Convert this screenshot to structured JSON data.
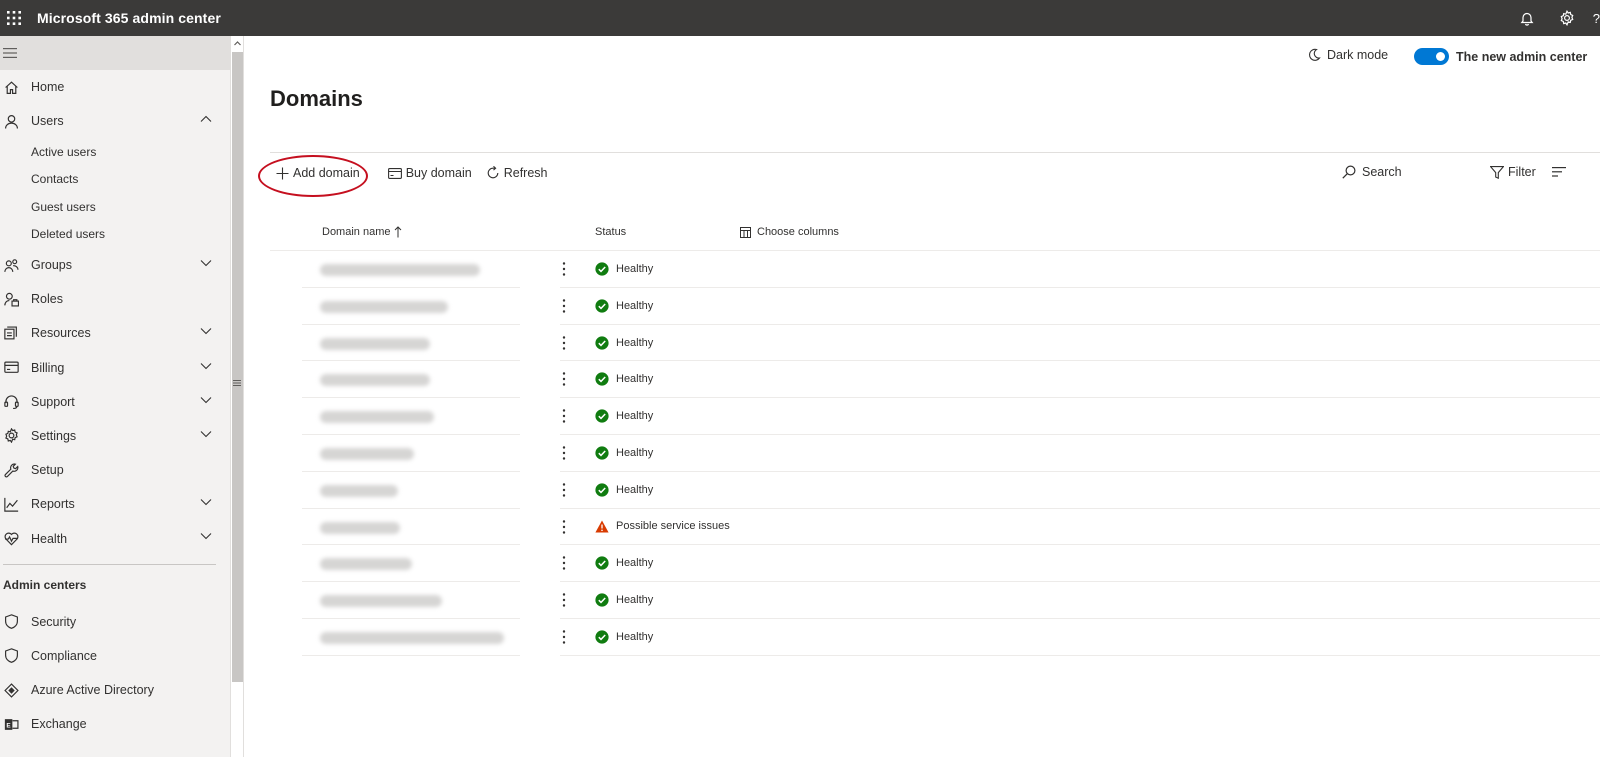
{
  "topbar": {
    "app_title": "Microsoft 365 admin center",
    "help": "?"
  },
  "sidebar": {
    "items": [
      {
        "label": "Home",
        "icon": "home-icon",
        "chevron": false
      },
      {
        "label": "Users",
        "icon": "user-icon",
        "chevron": "up"
      },
      {
        "label": "Groups",
        "icon": "groups-icon",
        "chevron": "down"
      },
      {
        "label": "Roles",
        "icon": "roles-icon",
        "chevron": false
      },
      {
        "label": "Resources",
        "icon": "resources-icon",
        "chevron": "down"
      },
      {
        "label": "Billing",
        "icon": "billing-icon",
        "chevron": "down"
      },
      {
        "label": "Support",
        "icon": "headset-icon",
        "chevron": "down"
      },
      {
        "label": "Settings",
        "icon": "gear-icon",
        "chevron": "down"
      },
      {
        "label": "Setup",
        "icon": "wrench-icon",
        "chevron": false
      },
      {
        "label": "Reports",
        "icon": "chart-icon",
        "chevron": "down"
      },
      {
        "label": "Health",
        "icon": "heart-pulse-icon",
        "chevron": "down"
      }
    ],
    "users_sub": [
      "Active users",
      "Contacts",
      "Guest users",
      "Deleted users"
    ],
    "admin_section": "Admin centers",
    "admin_items": [
      {
        "label": "Security",
        "icon": "shield-icon"
      },
      {
        "label": "Compliance",
        "icon": "shield-icon"
      },
      {
        "label": "Azure Active Directory",
        "icon": "azure-ad-icon"
      },
      {
        "label": "Exchange",
        "icon": "exchange-icon"
      }
    ]
  },
  "header": {
    "dark_mode": "Dark mode",
    "new_admin": "The new admin center",
    "page_title": "Domains"
  },
  "toolbar": {
    "add_domain": "Add domain",
    "buy_domain": "Buy domain",
    "refresh": "Refresh",
    "search": "Search",
    "filter": "Filter"
  },
  "table": {
    "col_domain": "Domain name",
    "col_status": "Status",
    "choose_columns": "Choose columns",
    "rows": [
      {
        "status": "Healthy",
        "state": "ok"
      },
      {
        "status": "Healthy",
        "state": "ok"
      },
      {
        "status": "Healthy",
        "state": "ok"
      },
      {
        "status": "Healthy",
        "state": "ok"
      },
      {
        "status": "Healthy",
        "state": "ok"
      },
      {
        "status": "Healthy",
        "state": "ok"
      },
      {
        "status": "Healthy",
        "state": "ok"
      },
      {
        "status": "Possible service issues",
        "state": "warning"
      },
      {
        "status": "Healthy",
        "state": "ok"
      },
      {
        "status": "Healthy",
        "state": "ok"
      },
      {
        "status": "Healthy",
        "state": "ok"
      }
    ]
  },
  "colors": {
    "accent": "#0078d4",
    "healthy": "#107c10",
    "warning": "#d83b01",
    "highlight": "#c50f1f"
  }
}
